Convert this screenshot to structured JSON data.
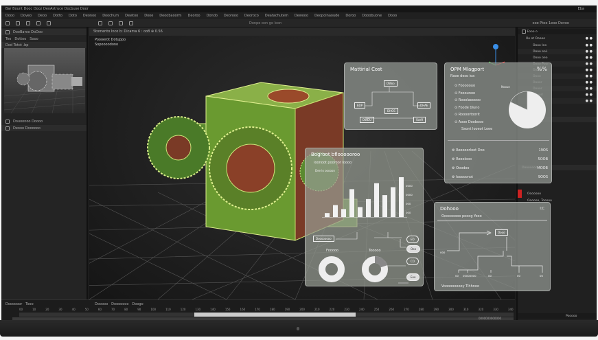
{
  "titlebar": {
    "title": "Bar Bount Dooc Dooz DeoAstruce Docbuse Door",
    "right": "Eba"
  },
  "menu": [
    "Dooo",
    "Doveo",
    "Deoo",
    "Dotto",
    "Doto",
    "Deonoo",
    "Doochum",
    "Dewtoo",
    "Dooe",
    "Deoobaoorm",
    "Deoroo",
    "Dondo",
    "Deorooo",
    "Deoroco",
    "Deatachutem",
    "Dewooo",
    "Deopoinaoude",
    "Doroo",
    "Dooobuone",
    "Dooo"
  ],
  "toolbar": {
    "search_placeholder": "Donpe oon go loon",
    "right_label": "ooe Ptoe 1eoe Devoo"
  },
  "left_panel": {
    "header": "DooBaroo DoDoo",
    "tabs": [
      "Teo",
      "Dottoo",
      "Sooo"
    ],
    "file": "Dod Totot .bp",
    "rows": [
      "Douoonoo Doooo",
      "Deooo Doooooo"
    ]
  },
  "viewport": {
    "header": "Stomento Inco b: Dicama 6 : oo8 ⊕ 0.56",
    "info_line1": "Poooerot Dotuppo",
    "info_line2": "Sopoooodono"
  },
  "material_cost": {
    "title": "Mattirial Cost",
    "nodes": [
      "DWoo",
      "EDP",
      "DHAE",
      "DHOS",
      "DWDU",
      "SoeR"
    ]
  },
  "opm_report": {
    "title": "OPM Mlagport",
    "subtitle": "Raoe deso ioa",
    "close_label": "%%",
    "items": [
      "Fooooouo",
      "Fooounoo",
      "Rooolaooooo",
      "Foode bluno",
      "Roooortoorit",
      "Aooe Doobooe"
    ],
    "footer": "Saont Iooeot Loee",
    "pie_label": "Nooun",
    "pie_slice_fraction": 0.18,
    "stats": [
      {
        "label": "Rooooorloot Doo",
        "value": "19OS"
      },
      {
        "label": "Rooolooo",
        "value": "5OOB"
      },
      {
        "label": "Ooodoo",
        "value": "MOOB"
      },
      {
        "label": "Iooooonot",
        "value": "9OOS"
      }
    ]
  },
  "bar_panel": {
    "title": "Bogroot bfloooooroo",
    "subtitle": "Ioonoot pooroor  Ioooo",
    "axis_label": "Dee lo ooooon",
    "bar_values": [
      1,
      3,
      2,
      7,
      2.5,
      4.5,
      8.5,
      5.5,
      7.5,
      10
    ],
    "right_ticks": [
      "oooo",
      "oooo",
      "ooo",
      "ooo"
    ],
    "flow_label": "Doooooooo",
    "pill_labels": [
      "EO",
      "Ooo",
      "CO",
      "Eoo"
    ],
    "donut1_label": "Fooooo",
    "donut2_label": "Tooooo",
    "donut2_fraction": 0.2
  },
  "diagram_panel": {
    "title": "Dohooo",
    "subtitle": "Ooooooooo pooog Yooo",
    "close_label": "I:C",
    "node": "Oooo",
    "leaf_labels": [
      "ooo",
      "oo",
      "oooooooo",
      "oo",
      "oo",
      "oo"
    ],
    "footer": "Voooooooooy Tihhnoo"
  },
  "outliner": {
    "header": "Eooo o",
    "root": "Uo ot Ooooo",
    "items": [
      "Oooo Ieo",
      "Oooo eoL",
      "Oooo oeo",
      "Oooo Poor",
      "Oood",
      "Oooo",
      "Oooor",
      "Oooor",
      "Ooood",
      "Oooo"
    ]
  },
  "properties": {
    "section1": "Ooooooo",
    "section2": "Oooooooo",
    "row1": "Ooooooo",
    "row2": "Oooooo, Tooooo",
    "footer": "Pooooo"
  },
  "timeline": {
    "left_labels": [
      "Doooooor",
      "Tooo"
    ],
    "tabs": [
      "Dooooo",
      "Dooooooo",
      "Doogo"
    ],
    "frames": [
      "00",
      "10",
      "20",
      "30",
      "40",
      "50",
      "60",
      "70",
      "80",
      "90",
      "100",
      "110",
      "120",
      "130",
      "140",
      "150",
      "160",
      "170",
      "180",
      "190",
      "200",
      "210",
      "220",
      "230",
      "240",
      "250",
      "260",
      "270",
      "280",
      "290",
      "300",
      "310",
      "320",
      "330",
      "340"
    ],
    "status": "0000000000000"
  },
  "colors": {
    "accent_blue": "#3a8fe8",
    "model_green": "#6aa83a",
    "model_red": "#8a3a28"
  }
}
